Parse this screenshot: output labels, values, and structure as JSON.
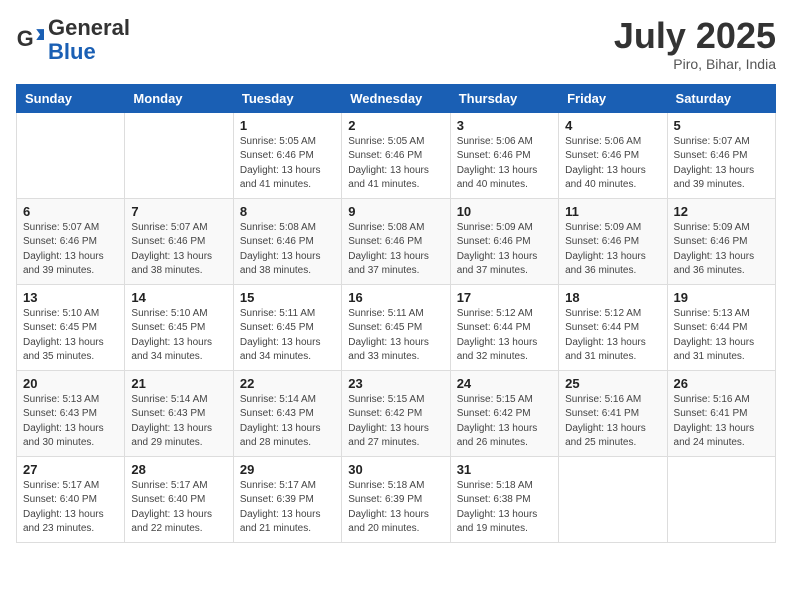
{
  "header": {
    "logo_general": "General",
    "logo_blue": "Blue",
    "month_title": "July 2025",
    "location": "Piro, Bihar, India"
  },
  "calendar": {
    "days_of_week": [
      "Sunday",
      "Monday",
      "Tuesday",
      "Wednesday",
      "Thursday",
      "Friday",
      "Saturday"
    ],
    "weeks": [
      [
        {
          "day": "",
          "info": ""
        },
        {
          "day": "",
          "info": ""
        },
        {
          "day": "1",
          "info": "Sunrise: 5:05 AM\nSunset: 6:46 PM\nDaylight: 13 hours and 41 minutes."
        },
        {
          "day": "2",
          "info": "Sunrise: 5:05 AM\nSunset: 6:46 PM\nDaylight: 13 hours and 41 minutes."
        },
        {
          "day": "3",
          "info": "Sunrise: 5:06 AM\nSunset: 6:46 PM\nDaylight: 13 hours and 40 minutes."
        },
        {
          "day": "4",
          "info": "Sunrise: 5:06 AM\nSunset: 6:46 PM\nDaylight: 13 hours and 40 minutes."
        },
        {
          "day": "5",
          "info": "Sunrise: 5:07 AM\nSunset: 6:46 PM\nDaylight: 13 hours and 39 minutes."
        }
      ],
      [
        {
          "day": "6",
          "info": "Sunrise: 5:07 AM\nSunset: 6:46 PM\nDaylight: 13 hours and 39 minutes."
        },
        {
          "day": "7",
          "info": "Sunrise: 5:07 AM\nSunset: 6:46 PM\nDaylight: 13 hours and 38 minutes."
        },
        {
          "day": "8",
          "info": "Sunrise: 5:08 AM\nSunset: 6:46 PM\nDaylight: 13 hours and 38 minutes."
        },
        {
          "day": "9",
          "info": "Sunrise: 5:08 AM\nSunset: 6:46 PM\nDaylight: 13 hours and 37 minutes."
        },
        {
          "day": "10",
          "info": "Sunrise: 5:09 AM\nSunset: 6:46 PM\nDaylight: 13 hours and 37 minutes."
        },
        {
          "day": "11",
          "info": "Sunrise: 5:09 AM\nSunset: 6:46 PM\nDaylight: 13 hours and 36 minutes."
        },
        {
          "day": "12",
          "info": "Sunrise: 5:09 AM\nSunset: 6:46 PM\nDaylight: 13 hours and 36 minutes."
        }
      ],
      [
        {
          "day": "13",
          "info": "Sunrise: 5:10 AM\nSunset: 6:45 PM\nDaylight: 13 hours and 35 minutes."
        },
        {
          "day": "14",
          "info": "Sunrise: 5:10 AM\nSunset: 6:45 PM\nDaylight: 13 hours and 34 minutes."
        },
        {
          "day": "15",
          "info": "Sunrise: 5:11 AM\nSunset: 6:45 PM\nDaylight: 13 hours and 34 minutes."
        },
        {
          "day": "16",
          "info": "Sunrise: 5:11 AM\nSunset: 6:45 PM\nDaylight: 13 hours and 33 minutes."
        },
        {
          "day": "17",
          "info": "Sunrise: 5:12 AM\nSunset: 6:44 PM\nDaylight: 13 hours and 32 minutes."
        },
        {
          "day": "18",
          "info": "Sunrise: 5:12 AM\nSunset: 6:44 PM\nDaylight: 13 hours and 31 minutes."
        },
        {
          "day": "19",
          "info": "Sunrise: 5:13 AM\nSunset: 6:44 PM\nDaylight: 13 hours and 31 minutes."
        }
      ],
      [
        {
          "day": "20",
          "info": "Sunrise: 5:13 AM\nSunset: 6:43 PM\nDaylight: 13 hours and 30 minutes."
        },
        {
          "day": "21",
          "info": "Sunrise: 5:14 AM\nSunset: 6:43 PM\nDaylight: 13 hours and 29 minutes."
        },
        {
          "day": "22",
          "info": "Sunrise: 5:14 AM\nSunset: 6:43 PM\nDaylight: 13 hours and 28 minutes."
        },
        {
          "day": "23",
          "info": "Sunrise: 5:15 AM\nSunset: 6:42 PM\nDaylight: 13 hours and 27 minutes."
        },
        {
          "day": "24",
          "info": "Sunrise: 5:15 AM\nSunset: 6:42 PM\nDaylight: 13 hours and 26 minutes."
        },
        {
          "day": "25",
          "info": "Sunrise: 5:16 AM\nSunset: 6:41 PM\nDaylight: 13 hours and 25 minutes."
        },
        {
          "day": "26",
          "info": "Sunrise: 5:16 AM\nSunset: 6:41 PM\nDaylight: 13 hours and 24 minutes."
        }
      ],
      [
        {
          "day": "27",
          "info": "Sunrise: 5:17 AM\nSunset: 6:40 PM\nDaylight: 13 hours and 23 minutes."
        },
        {
          "day": "28",
          "info": "Sunrise: 5:17 AM\nSunset: 6:40 PM\nDaylight: 13 hours and 22 minutes."
        },
        {
          "day": "29",
          "info": "Sunrise: 5:17 AM\nSunset: 6:39 PM\nDaylight: 13 hours and 21 minutes."
        },
        {
          "day": "30",
          "info": "Sunrise: 5:18 AM\nSunset: 6:39 PM\nDaylight: 13 hours and 20 minutes."
        },
        {
          "day": "31",
          "info": "Sunrise: 5:18 AM\nSunset: 6:38 PM\nDaylight: 13 hours and 19 minutes."
        },
        {
          "day": "",
          "info": ""
        },
        {
          "day": "",
          "info": ""
        }
      ]
    ]
  }
}
